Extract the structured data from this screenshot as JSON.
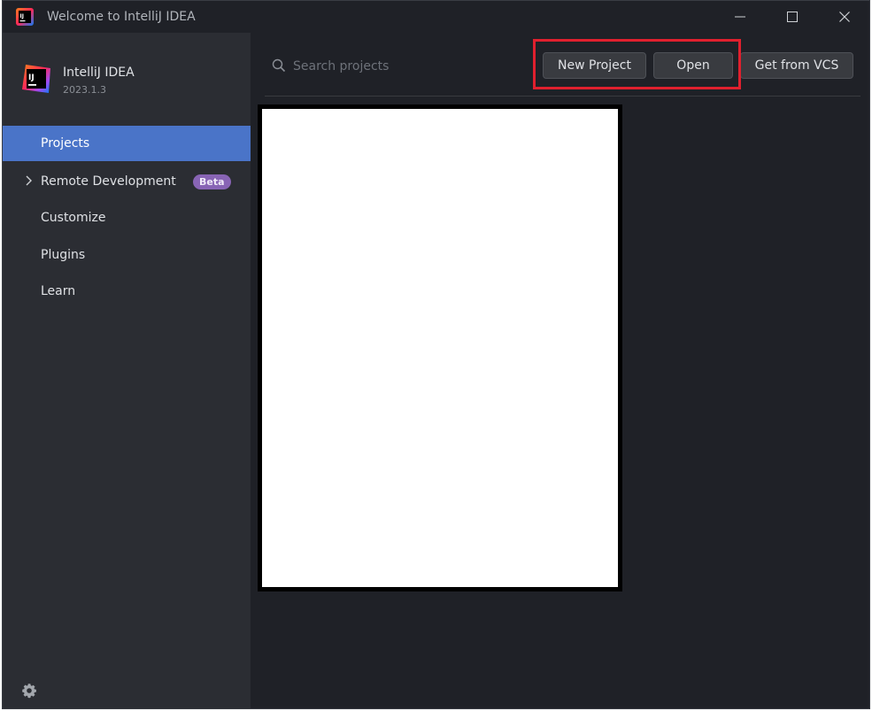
{
  "window": {
    "title": "Welcome to IntelliJ IDEA"
  },
  "brand": {
    "name": "IntelliJ IDEA",
    "version": "2023.1.3",
    "icon_letters": "IJ"
  },
  "sidebar": {
    "items": [
      {
        "label": "Projects",
        "active": true
      },
      {
        "label": "Remote Development",
        "badge": "Beta",
        "expandable": true
      },
      {
        "label": "Customize"
      },
      {
        "label": "Plugins"
      },
      {
        "label": "Learn"
      }
    ],
    "footer_icon": "gear-icon"
  },
  "main": {
    "search": {
      "placeholder": "Search projects",
      "value": ""
    },
    "buttons": {
      "new_project": "New Project",
      "open": "Open",
      "get_from_vcs": "Get from VCS"
    }
  },
  "colors": {
    "accent": "#4a74c8",
    "highlight": "#e0202e",
    "badge": "#8864b5"
  }
}
